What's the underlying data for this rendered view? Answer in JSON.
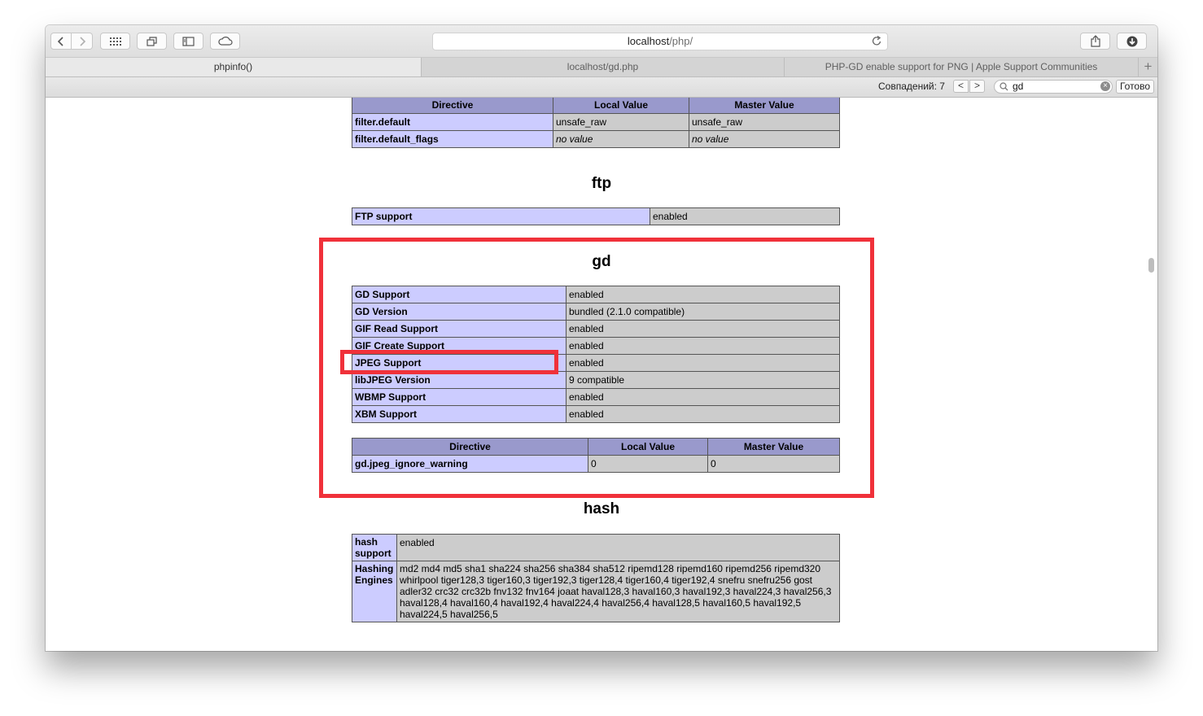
{
  "browser": {
    "url_host": "localhost",
    "url_path": "/php/",
    "tabs": [
      {
        "label": "phpinfo()"
      },
      {
        "label": "localhost/gd.php"
      },
      {
        "label": "PHP-GD enable support for PNG | Apple Support Communities"
      }
    ],
    "new_tab_label": "+",
    "find": {
      "matches_label": "Совпадений: 7",
      "query": "gd",
      "done_label": "Готово",
      "prev_label": "<",
      "next_label": ">"
    }
  },
  "headers": {
    "directive": "Directive",
    "local": "Local Value",
    "master": "Master Value"
  },
  "filter_table": {
    "rows": [
      {
        "name": "filter.default",
        "local": "unsafe_raw",
        "master": "unsafe_raw"
      },
      {
        "name": "filter.default_flags",
        "local": "no value",
        "master": "no value"
      }
    ]
  },
  "ftp": {
    "title": "ftp",
    "rows": [
      {
        "name": "FTP support",
        "value": "enabled"
      }
    ]
  },
  "gd": {
    "title": "gd",
    "rows": [
      {
        "name": "GD Support",
        "value": "enabled"
      },
      {
        "name": "GD Version",
        "value": "bundled (2.1.0 compatible)"
      },
      {
        "name": "GIF Read Support",
        "value": "enabled"
      },
      {
        "name": "GIF Create Support",
        "value": "enabled"
      },
      {
        "name": "JPEG Support",
        "value": "enabled"
      },
      {
        "name": "libJPEG Version",
        "value": "9 compatible"
      },
      {
        "name": "WBMP Support",
        "value": "enabled"
      },
      {
        "name": "XBM Support",
        "value": "enabled"
      }
    ],
    "directives": [
      {
        "name": "gd.jpeg_ignore_warning",
        "local": "0",
        "master": "0"
      }
    ]
  },
  "hash": {
    "title": "hash",
    "support_name_l1": "hash",
    "support_name_l2": "support",
    "support_value": "enabled",
    "engines_name_l1": "Hashing",
    "engines_name_l2": "Engines",
    "engines_lines": [
      "md2 md4 md5 sha1 sha224 sha256 sha384 sha512 ripemd128 ripemd160 ripemd256 ripemd320",
      "whirlpool tiger128,3 tiger160,3 tiger192,3 tiger128,4 tiger160,4 tiger192,4 snefru snefru256 gost",
      "adler32 crc32 crc32b fnv132 fnv164 joaat haval128,3 haval160,3 haval192,3 haval224,3 haval256,3",
      "haval128,4 haval160,4 haval192,4 haval224,4 haval256,4 haval128,5 haval160,5 haval192,5",
      "haval224,5 haval256,5"
    ]
  },
  "annotation_color": "#f0313a",
  "icons": [
    "back-icon",
    "forward-icon",
    "grid-icon",
    "tabs-icon",
    "sidebar-icon",
    "cloud-icon",
    "reload-icon",
    "share-icon",
    "download-icon",
    "search-icon",
    "clear-icon"
  ]
}
